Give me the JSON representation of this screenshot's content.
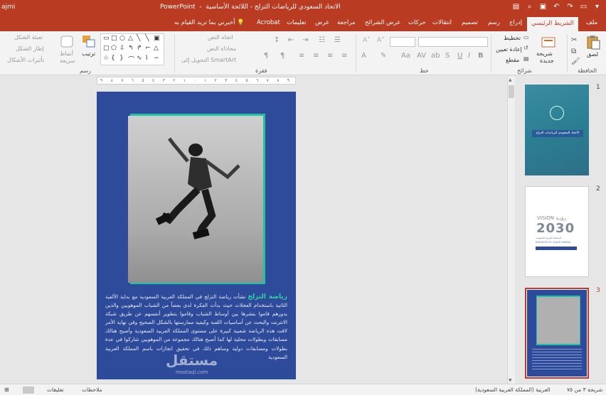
{
  "window": {
    "title": "الاتحاد السعودي للرياضات التزلج - اللائحة الأساسية",
    "app_name": "PowerPoint",
    "user": "ajmi"
  },
  "tabs": [
    {
      "label": "ملف"
    },
    {
      "label": "الشريط الرئيسي",
      "active": true
    },
    {
      "label": "إدراج"
    },
    {
      "label": "رسم"
    },
    {
      "label": "تصميم"
    },
    {
      "label": "انتقالات"
    },
    {
      "label": "حركات"
    },
    {
      "label": "عرض الشرائح"
    },
    {
      "label": "مراجعة"
    },
    {
      "label": "عرض"
    },
    {
      "label": "تعليمات"
    },
    {
      "label": "Acrobat"
    }
  ],
  "tell_me": "أخبرني بما تريد القيام به",
  "ribbon": {
    "clipboard": {
      "paste": "لصق",
      "label": "الحافظة"
    },
    "slides": {
      "new_slide": "شريحة",
      "new_slide_2": "جديدة",
      "layout": "تخطيط",
      "reset": "إعادة تعيين",
      "section": "مقطع",
      "label": "شرائح"
    },
    "font": {
      "label": "خط"
    },
    "paragraph": {
      "text_direction": "اتجاه النص",
      "align_text": "محاذاة النص",
      "smartart": "التحويل إلى SmartArt",
      "label": "فقرة"
    },
    "drawing": {
      "arrange": "ترتيب",
      "quick_styles": "أنماط",
      "quick_styles_2": "سريعة",
      "fill": "تعبئة الشكل",
      "outline": "إطار الشكل",
      "effects": "تأثيرات الأشكال",
      "label": "رسم"
    }
  },
  "slide": {
    "highlight": "رياضة التزلج",
    "body": "نشأت رياضة التزلج في المملكة العربية السعودية مع بداية الألفية الثانية باستخدام العجلات حيث بدأت الفكرة لدى بعضاً من الشباب الموهوبين والذين بدورهم قاموا بنشرها بين أوساط الشباب وقاموا بتطوير أنفسهم عن طريق شبكة الانترنت والبحث عن أساسيات اللعبة وكيفية ممارستها بالشكل الصحيح وفي نهاية الأمر لاقت هذه الرياضة شعبية كبيرة على مستوى المملكة العربية السعودية وأصبح هنالك مسابقات وبطولات محلية لها كما أصبح هنالك مجموعة من الموهوبين شاركوا في عدة بطولات ومسابقات دولية وساهم ذلك في تحقيق انجازات باسم المملكة العربية السعودية"
  },
  "watermark": {
    "text": "مستقل",
    "sub": "mostaql.com"
  },
  "thumbnails": [
    {
      "number": "1",
      "caption": "الاتحاد السعودي للرياضات التزلج"
    },
    {
      "number": "2",
      "vision_label": "VISION رؤيـة",
      "year": "2030",
      "sub": "المملكة العربية السعودية",
      "sub_en": "KINGDOM OF SAUDI ARABIA"
    },
    {
      "number": "3",
      "active": true
    }
  ],
  "status": {
    "slide_counter": "شريحة ٣ من ٧٥",
    "language": "العربية (المملكة العربية السعودية)",
    "notes": "ملاحظات",
    "comments": "تعليقات"
  },
  "ruler_numbers": [
    "٩",
    "٨",
    "٧",
    "٦",
    "٥",
    "٤",
    "٣",
    "٢",
    "١",
    "٠",
    "١",
    "٢",
    "٣",
    "٤",
    "٥",
    "٦",
    "٧",
    "٨",
    "٩"
  ],
  "colors": {
    "accent": "#b83b22",
    "slide_bg": "#2e4a9a",
    "teal": "#21c2a2",
    "highlight_text": "#2fd3a8"
  }
}
